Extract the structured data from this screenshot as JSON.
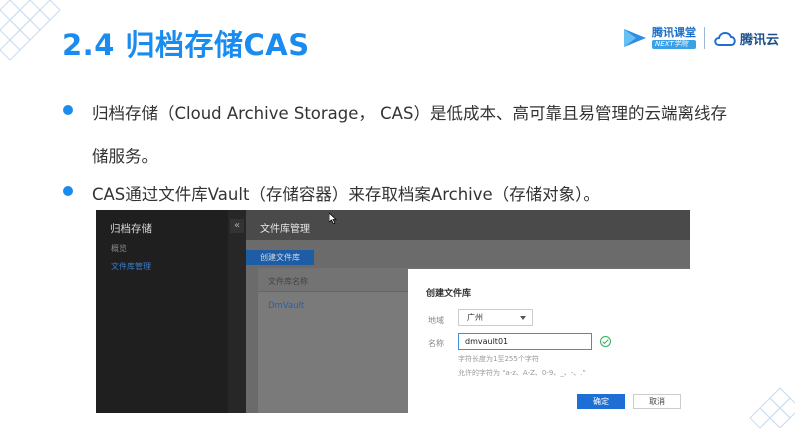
{
  "slide": {
    "title": "2.4 归档存储CAS",
    "bullets": [
      "归档存储（Cloud Archive Storage， CAS）是低成本、高可靠且易管理的云端离线存",
      "储服务。",
      "CAS通过文件库Vault（存储容器）来存取档案Archive（存储对象）。"
    ],
    "accent_color": "#1a8cf0"
  },
  "logos": {
    "ketang_name": "腾讯课堂",
    "ketang_sub": "NEXT学院",
    "cloud_name": "腾讯云",
    "icons": [
      "ketang-play-icon",
      "tencent-cloud-icon"
    ]
  },
  "console": {
    "sidebar_title": "归档存储",
    "collapse_glyph": "«",
    "sidebar_items": [
      "概览",
      "文件库管理"
    ],
    "page_title": "文件库管理",
    "create_button": "创建文件库",
    "table_header": "文件库名称",
    "rows": [
      "DmVault"
    ],
    "dialog": {
      "title": "创建文件库",
      "region_label": "地域",
      "region_value": "广州",
      "name_label": "名称",
      "name_value": "dmvault01",
      "hint_length": "字符长度为1至255个字符",
      "hint_chars": "允许的字符为 \"a-z、A-Z、0-9、_、-、.\"",
      "ok_button": "确定",
      "cancel_button": "取消"
    }
  }
}
